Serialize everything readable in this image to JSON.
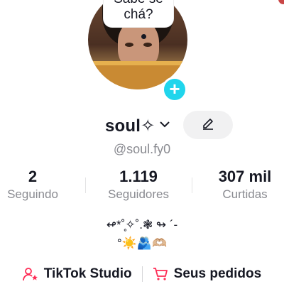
{
  "profile": {
    "bubble_text": "Sabe se chá?",
    "username": "soul✧",
    "handle": "@soul.fy0",
    "bio_line1": "↫*˚̥✧˚.❃ ↬ ´-",
    "bio_line2": "°☀️🫂🫶🏼"
  },
  "stats": [
    {
      "value": "2",
      "label": "Seguindo"
    },
    {
      "value": "1.119",
      "label": "Seguidores"
    },
    {
      "value": "307 mil",
      "label": "Curtidas"
    }
  ],
  "links": {
    "studio": "TikTok Studio",
    "orders": "Seus pedidos"
  },
  "colors": {
    "accent": "#20d5ec",
    "pink": "#fe2c55",
    "muted": "#8a8b91"
  }
}
